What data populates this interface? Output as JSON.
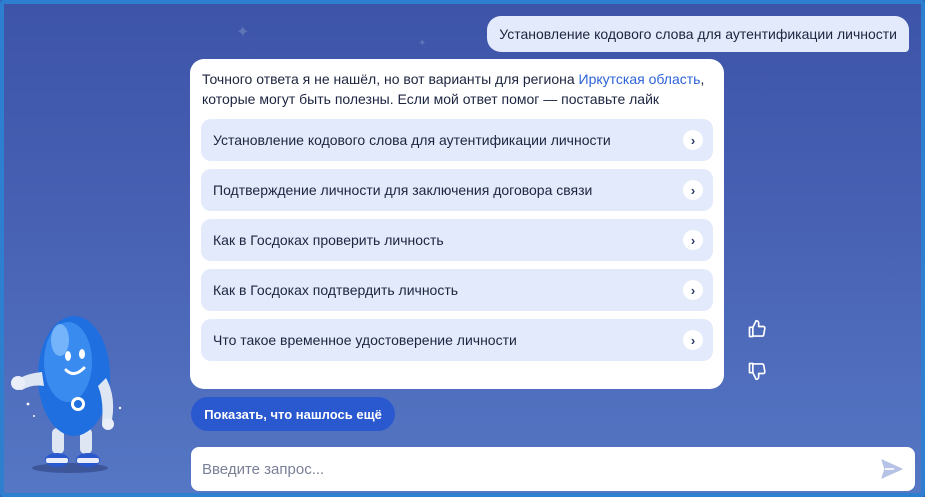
{
  "chat": {
    "user_message": "Установление кодового слова для аутентификации личности",
    "bot": {
      "intro_before": "Точного ответа я не нашёл, но вот варианты для региона ",
      "region_link": "Иркутская область",
      "intro_after": ", которые могут быть полезны. Если мой ответ помог — поставьте лайк",
      "options": [
        "Установление кодового слова для аутентификации личности",
        "Подтверждение личности для заключения договора связи",
        "Как в Госдоках проверить личность",
        "Как в Госдоках подтвердить личность",
        "Что такое временное удостоверение личности"
      ]
    },
    "show_more_label": "Показать, что нашлось ещё"
  },
  "input": {
    "placeholder": "Введите запрос..."
  },
  "icons": {
    "like": "thumbs-up-icon",
    "dislike": "thumbs-down-icon",
    "send": "send-icon",
    "chevron": "chevron-right-icon"
  },
  "colors": {
    "accent": "#2a58cf",
    "link": "#2d63d8",
    "option_bg": "#e3eafb",
    "background": "#4861b3"
  }
}
